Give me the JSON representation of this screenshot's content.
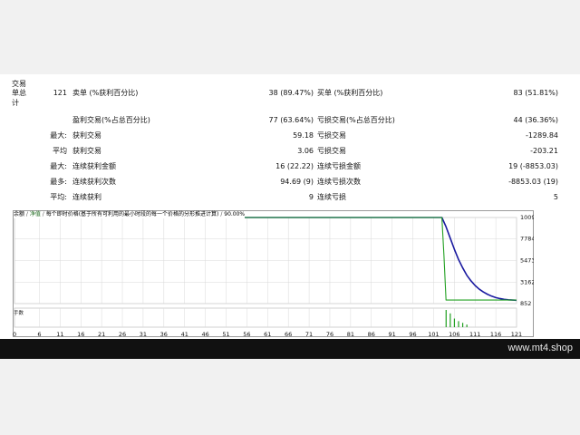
{
  "stats": {
    "col_a": {
      "trades_line1": "交易",
      "trades_line2": "单总",
      "trades_line3": "计",
      "largest": "最大:",
      "average": "平均",
      "max1": "最大:",
      "max2": "最多:",
      "avg": "平均:"
    },
    "total_trades": "121",
    "labels_left": {
      "short": "卖单 (%获利百分比)",
      "profit_trades": "盈利交易(%占总百分比)",
      "largest_profit": "获利交易",
      "avg_profit": "获利交易",
      "max_consec_profit_amount": "连续获利金额",
      "max_consec_wins": "连续获利次数",
      "avg_consec_wins": "连续获利"
    },
    "values_left": {
      "short": "38 (89.47%)",
      "profit_trades": "77 (63.64%)",
      "largest_profit": "59.18",
      "avg_profit": "3.06",
      "max_consec_profit_amount": "16 (22.22)",
      "max_consec_wins": "94.69 (9)",
      "avg_consec_wins": "9"
    },
    "labels_right": {
      "long": "买单 (%获利百分比)",
      "loss_trades": "亏损交易(%占总百分比)",
      "largest_loss": "亏损交易",
      "avg_loss": "亏损交易",
      "max_consec_loss_amount": "连续亏损金额",
      "max_consec_losses": "连续亏损次数",
      "avg_consec_losses": "连续亏损"
    },
    "values_right": {
      "long": "83 (51.81%)",
      "loss_trades": "44 (36.36%)",
      "largest_loss": "-1289.84",
      "avg_loss": "-203.21",
      "max_consec_loss_amount": "19 (-8853.03)",
      "max_consec_losses": "-8853.03 (19)",
      "avg_consec_losses": "5"
    }
  },
  "chart": {
    "legend": {
      "balance": "余额",
      "sep1": " / ",
      "equity": "净值",
      "sep2": " / ",
      "model": "每个即时价格(基于所有可利用的最小时段的每一个价格的分形推进计算)",
      "sep3": " / ",
      "quality": "90.00%"
    },
    "volume_label": "手数",
    "colors": {
      "balance": "#1a1aa0",
      "equity": "#22a022",
      "grid": "#d8d8d8",
      "volume": "#22a022"
    }
  },
  "chart_data": {
    "type": "line",
    "title": "",
    "xlabel": "",
    "ylabel": "",
    "x_ticks": [
      0,
      6,
      11,
      16,
      21,
      26,
      31,
      36,
      41,
      46,
      51,
      56,
      61,
      66,
      71,
      76,
      81,
      86,
      91,
      96,
      101,
      106,
      111,
      116,
      121
    ],
    "y_ticks": [
      10094,
      7784,
      5473,
      3162,
      852
    ],
    "xlim": [
      0,
      121
    ],
    "ylim": [
      852,
      10094
    ],
    "series": [
      {
        "name": "余额",
        "x": [
          0,
          103,
          104,
          105,
          106,
          107,
          108,
          109,
          110,
          111,
          112,
          113,
          114,
          115,
          116,
          117,
          118,
          119,
          120,
          121
        ],
        "values": [
          10094,
          10094,
          9100,
          7900,
          6700,
          5600,
          4700,
          3900,
          3300,
          2800,
          2400,
          2100,
          1850,
          1650,
          1500,
          1390,
          1310,
          1260,
          1230,
          1210
        ]
      },
      {
        "name": "净值",
        "x": [
          0,
          103,
          103.5,
          104,
          121
        ],
        "values": [
          10094,
          10094,
          6000,
          1230,
          1230
        ]
      }
    ],
    "volume": {
      "x": [
        104,
        105,
        106,
        107,
        108,
        109
      ],
      "values": [
        1.0,
        0.8,
        0.5,
        0.35,
        0.25,
        0.15
      ]
    }
  },
  "watermark": "www.mt4.shop"
}
